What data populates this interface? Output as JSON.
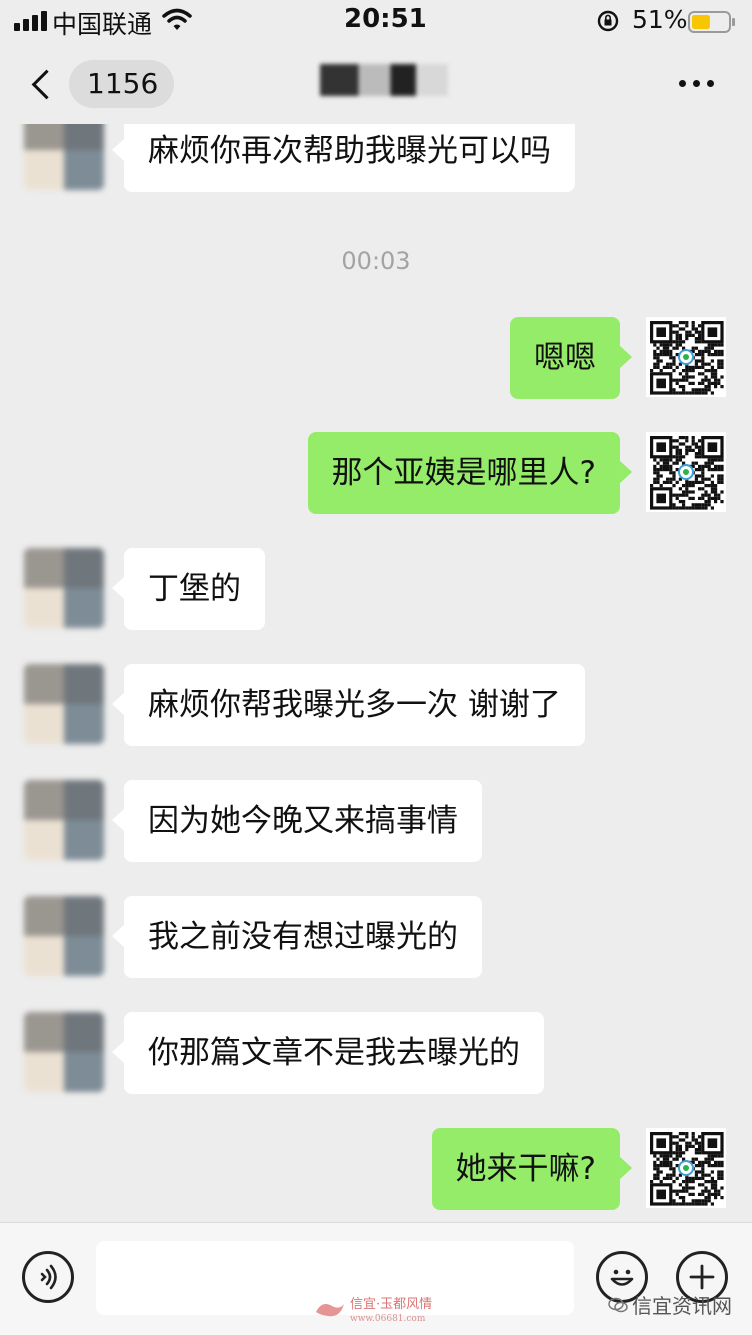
{
  "status_bar": {
    "carrier": "中国联通",
    "time": "20:51",
    "battery_percent": "51%",
    "battery_level": 0.51,
    "battery_color": "#f7c600"
  },
  "nav": {
    "unread_count": "1156",
    "back_icon": "chevron-left-icon",
    "more_icon": "ellipsis-icon"
  },
  "chat": {
    "timestamp": "00:03",
    "messages": [
      {
        "side": "left",
        "text": "麻烦你再次帮助我曝光可以吗"
      },
      {
        "side": "right",
        "text": "嗯嗯"
      },
      {
        "side": "right",
        "text": "那个亚姨是哪里人?"
      },
      {
        "side": "left",
        "text": "丁堡的"
      },
      {
        "side": "left",
        "text": "麻烦你帮我曝光多一次 谢谢了"
      },
      {
        "side": "left",
        "text": "因为她今晚又来搞事情"
      },
      {
        "side": "left",
        "text": "我之前没有想过曝光的"
      },
      {
        "side": "left",
        "text": "你那篇文章不是我去曝光的"
      },
      {
        "side": "right",
        "text": "她来干嘛?"
      }
    ]
  },
  "input_bar": {
    "voice_icon": "voice-icon",
    "emoji_icon": "emoji-icon",
    "plus_icon": "plus-icon",
    "input_value": ""
  },
  "watermarks": {
    "site_name": "信宜·玉都风情",
    "site_url": "www.06681.com",
    "account": "信宜资讯网"
  },
  "colors": {
    "background": "#ededed",
    "right_bubble": "#95ec69",
    "left_bubble": "#ffffff",
    "timestamp": "#a3a3a3"
  }
}
